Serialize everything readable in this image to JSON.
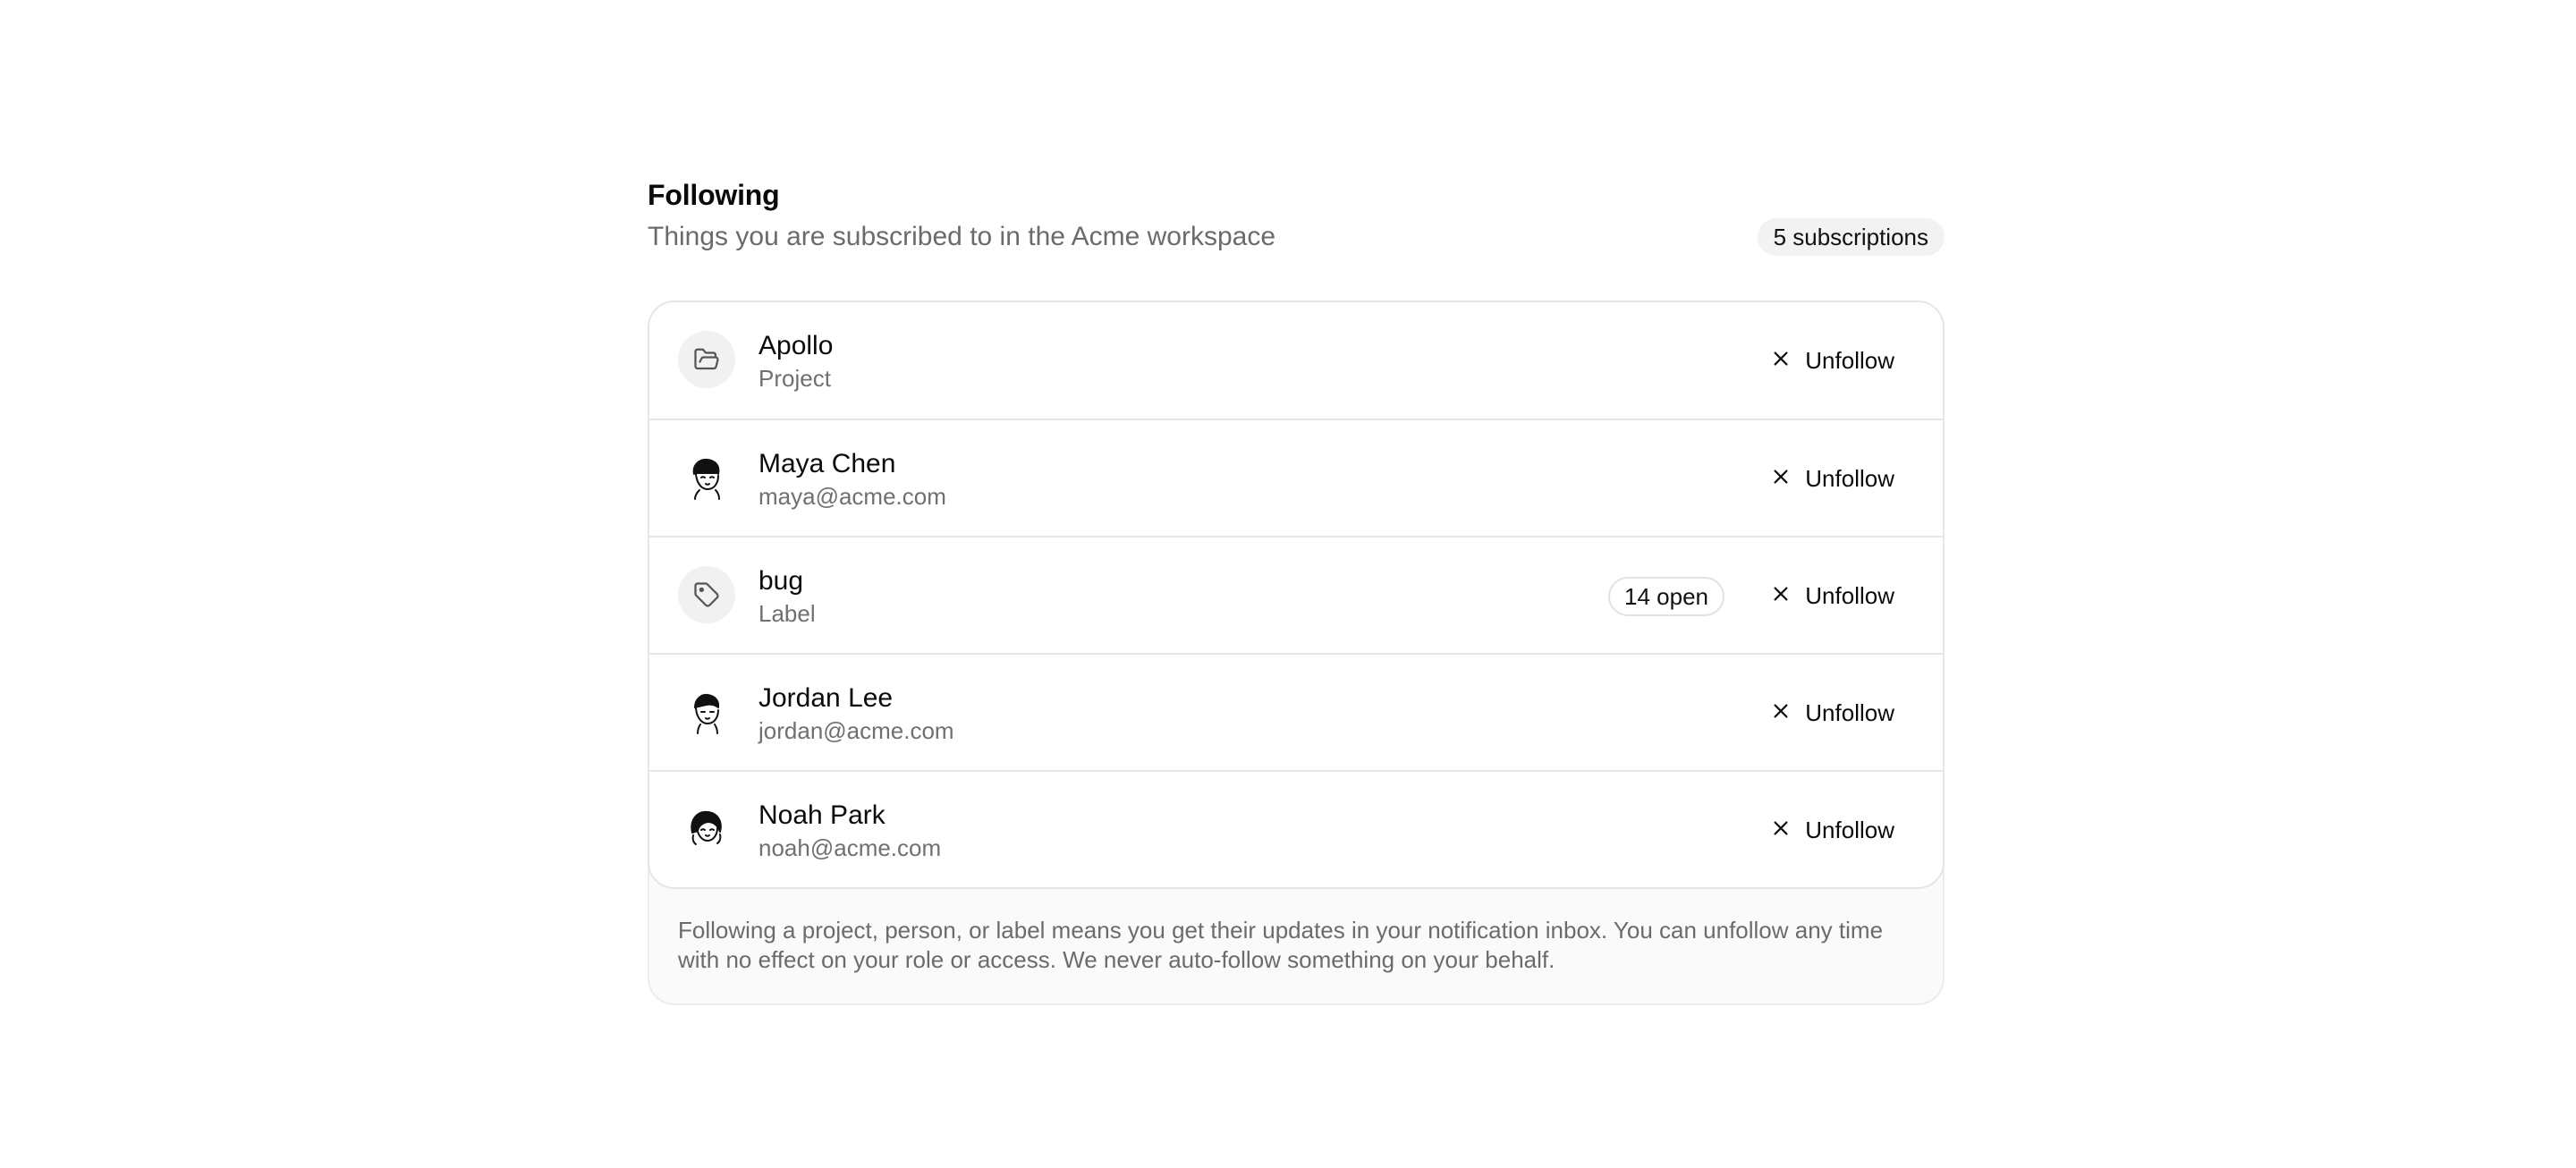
{
  "header": {
    "title": "Following",
    "subtitle": "Things you are subscribed to in the Acme workspace",
    "count_badge": "5 subscriptions"
  },
  "items": [
    {
      "name": "Apollo",
      "meta": "Project",
      "icon": "folder-open-icon",
      "unfollow_label": "Unfollow"
    },
    {
      "name": "Maya Chen",
      "meta": "maya@acme.com",
      "icon": "avatar",
      "unfollow_label": "Unfollow"
    },
    {
      "name": "bug",
      "meta": "Label",
      "icon": "tag-icon",
      "badge": "14 open",
      "unfollow_label": "Unfollow"
    },
    {
      "name": "Jordan Lee",
      "meta": "jordan@acme.com",
      "icon": "avatar",
      "unfollow_label": "Unfollow"
    },
    {
      "name": "Noah Park",
      "meta": "noah@acme.com",
      "icon": "avatar",
      "unfollow_label": "Unfollow"
    }
  ],
  "footer": {
    "note": "Following a project, person, or label means you get their updates in your notification inbox. You can unfollow any time with no effect on your role or access. We never auto-follow something on your behalf."
  },
  "colors": {
    "text": "#0a0a0a",
    "muted": "#6b6b6b",
    "border": "#e6e6e6",
    "badge_bg": "#f2f2f2",
    "footer_bg": "#fafafa"
  }
}
